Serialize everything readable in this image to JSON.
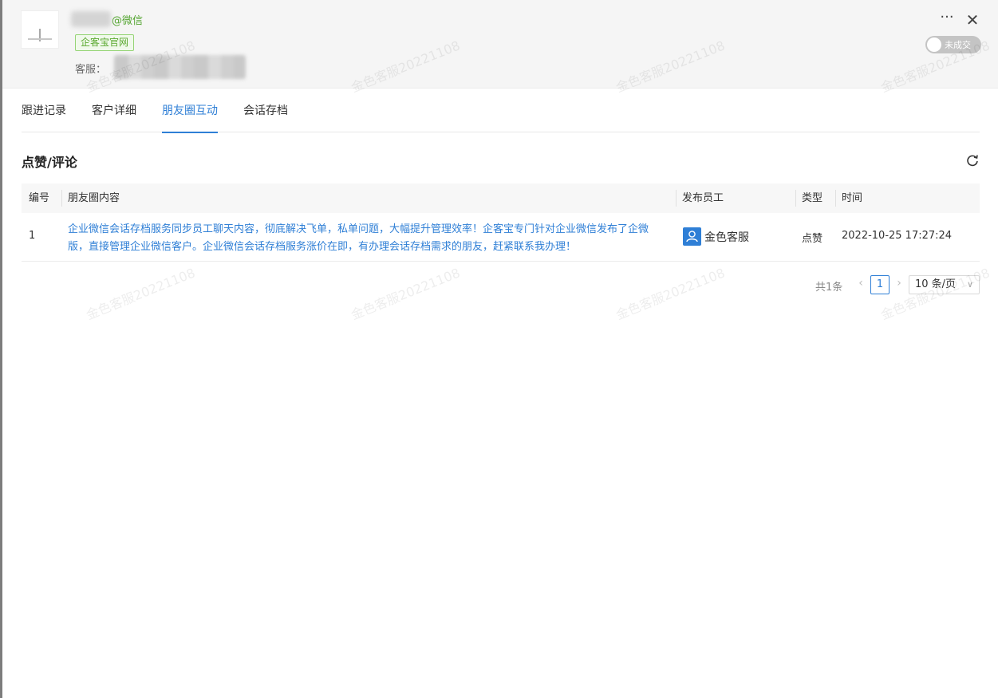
{
  "header": {
    "wechat_suffix": "@微信",
    "source_tag": "企客宝官网",
    "agent_label": "客服：",
    "more_glyph": "···",
    "close_glyph": "✕",
    "deal_status": "未成交"
  },
  "tabs": [
    {
      "label": "跟进记录"
    },
    {
      "label": "客户详细"
    },
    {
      "label": "朋友圈互动"
    },
    {
      "label": "会话存档"
    }
  ],
  "active_tab": "朋友圈互动",
  "section": {
    "title": "点赞/评论"
  },
  "table": {
    "columns": [
      "编号",
      "朋友圈内容",
      "发布员工",
      "类型",
      "时间"
    ],
    "rows": [
      {
        "id": "1",
        "content": "企业微信会话存档服务同步员工聊天内容，彻底解决飞单，私单问题，大幅提升管理效率！企客宝专门针对企业微信发布了企微版，直接管理企业微信客户。企业微信会话存档服务涨价在即，有办理会话存档需求的朋友，赶紧联系我办理！",
        "staff": "金色客服",
        "type": "点赞",
        "time": "2022-10-25 17:27:24"
      }
    ]
  },
  "pagination": {
    "total": "共1条",
    "current": "1",
    "page_size": "10 条/页"
  },
  "watermark": {
    "text": "金色客服20221108"
  },
  "colors": {
    "primary": "#2f7fd6",
    "tag_green": "#59a82e",
    "header_bg": "#f5f5f5"
  },
  "icons": [
    "more-icon",
    "close-icon",
    "refresh-icon",
    "user-icon",
    "chevron-left-icon",
    "chevron-right-icon",
    "chevron-down-icon"
  ]
}
